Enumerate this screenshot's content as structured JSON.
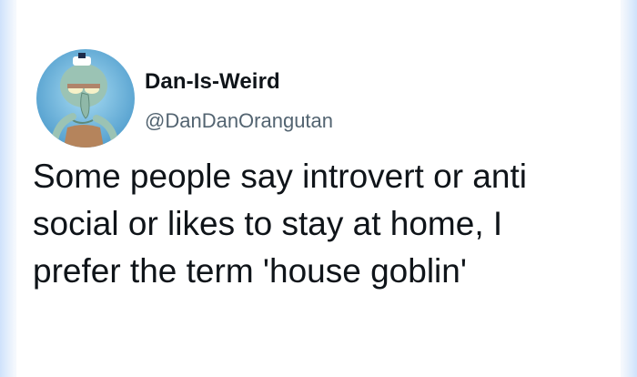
{
  "tweet": {
    "author": {
      "display_name": "Dan-Is-Weird",
      "handle": "@DanDanOrangutan",
      "avatar_icon": "squidward-avatar-icon"
    },
    "text_lines": [
      "Some people say introvert or anti",
      "social or likes to stay at home, I",
      "prefer the term 'house goblin'"
    ]
  },
  "colors": {
    "text_primary": "#0f1419",
    "text_secondary": "#536471",
    "avatar_background": "#6fb7de"
  }
}
